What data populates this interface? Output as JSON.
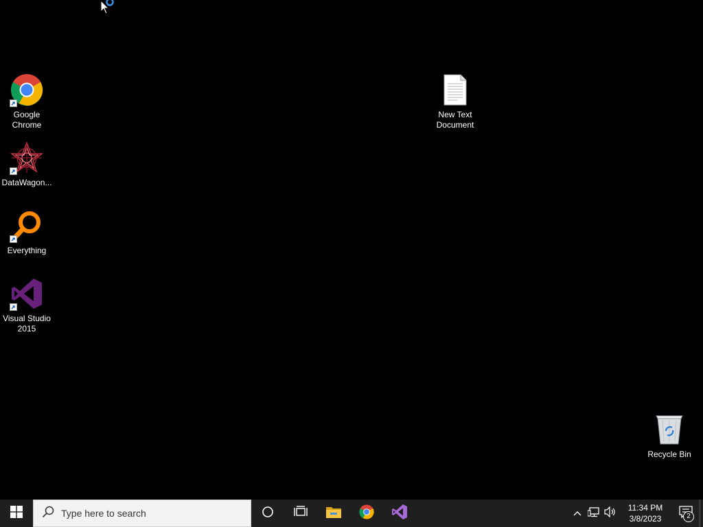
{
  "desktop": {
    "icons": [
      {
        "label": "Google\nChrome",
        "icon": "chrome-icon"
      },
      {
        "label": "DataWagon...",
        "icon": "datawagon-icon"
      },
      {
        "label": "Everything",
        "icon": "everything-icon"
      },
      {
        "label": "Visual Studio\n2015",
        "icon": "visual-studio-icon"
      },
      {
        "label": "New Text\nDocument",
        "icon": "text-document-icon"
      },
      {
        "label": "Recycle Bin",
        "icon": "recycle-bin-icon"
      }
    ]
  },
  "taskbar": {
    "search_placeholder": "Type here to search",
    "clock_time": "11:34 PM",
    "clock_date": "3/8/2023",
    "notification_count": "2",
    "pinned": [
      "file-explorer-icon",
      "chrome-icon",
      "visual-studio-icon"
    ]
  },
  "colors": {
    "desktop_bg": "#000000",
    "taskbar_bg": "#1f1f1f",
    "vs_purple": "#68217a",
    "explorer_yellow": "#f7c441"
  }
}
